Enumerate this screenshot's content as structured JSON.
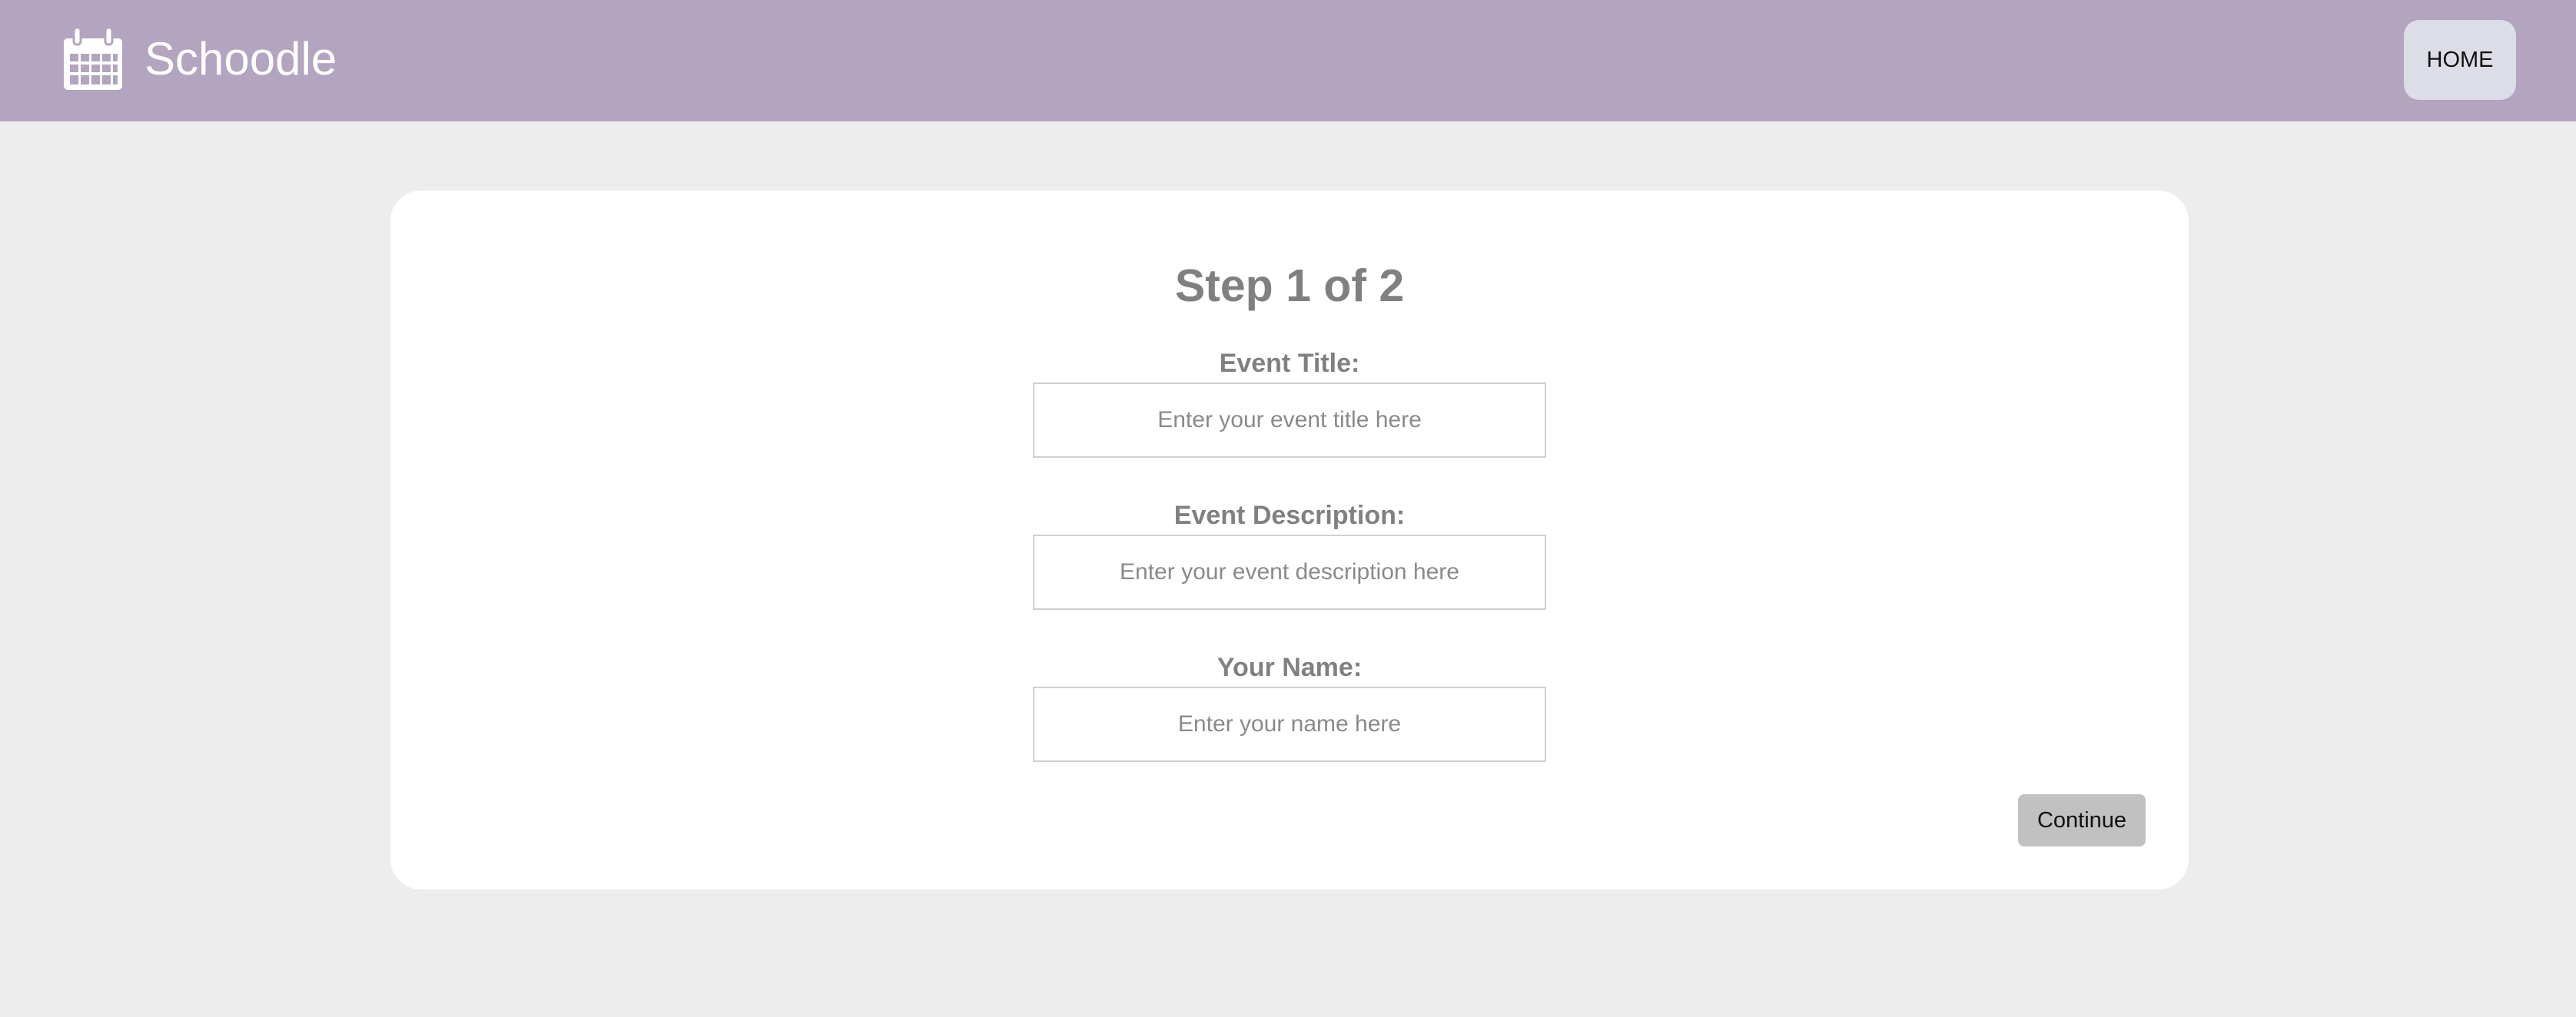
{
  "header": {
    "brand_name": "Schoodle",
    "brand_icon": "calendar-icon",
    "home_label": "HOME",
    "background_color": "#b3a4bf"
  },
  "form": {
    "step_title": "Step 1 of 2",
    "fields": [
      {
        "label": "Event Title:",
        "placeholder": "Enter your event title here",
        "value": ""
      },
      {
        "label": "Event Description:",
        "placeholder": "Enter your event description here",
        "value": ""
      },
      {
        "label": "Your Name:",
        "placeholder": "Enter your name here",
        "value": ""
      }
    ],
    "continue_label": "Continue"
  }
}
